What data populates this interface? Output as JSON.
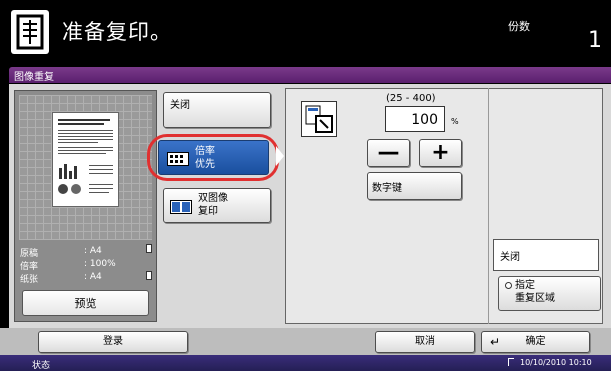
{
  "header": {
    "title": "准备复印。",
    "copies_label": "份数",
    "copies_value": "1"
  },
  "subheader": {
    "title": "图像重复"
  },
  "preview": {
    "original_label": "原稿",
    "original_value": ": A4",
    "ratio_label": "倍率",
    "ratio_value": ": 100%",
    "paper_label": "纸张",
    "paper_value": ": A4",
    "preview_button": "预览"
  },
  "modes": {
    "off_label": "关闭",
    "zoom_priority_line1": "倍率",
    "zoom_priority_line2": "优先",
    "dual_line1": "双图像",
    "dual_line2": "复印"
  },
  "zoom": {
    "range": "(25 - 400)",
    "value": "100",
    "unit": "%",
    "minus": "—",
    "plus": "+",
    "numeric_keys": "数字键"
  },
  "area": {
    "off_label": "关闭",
    "specify_line1": "指定",
    "specify_line2": "重复区域"
  },
  "footer": {
    "login": "登录",
    "cancel": "取消",
    "ok": "确定"
  },
  "status": {
    "label": "状态",
    "datetime": "10/10/2010  10:10"
  },
  "colors": {
    "header_bg": "#000000",
    "subheader_bg": "#6b2d7d",
    "selected_btn": "#2a62b8",
    "highlight_ring": "#e03030",
    "status_bg": "#2f2668"
  }
}
